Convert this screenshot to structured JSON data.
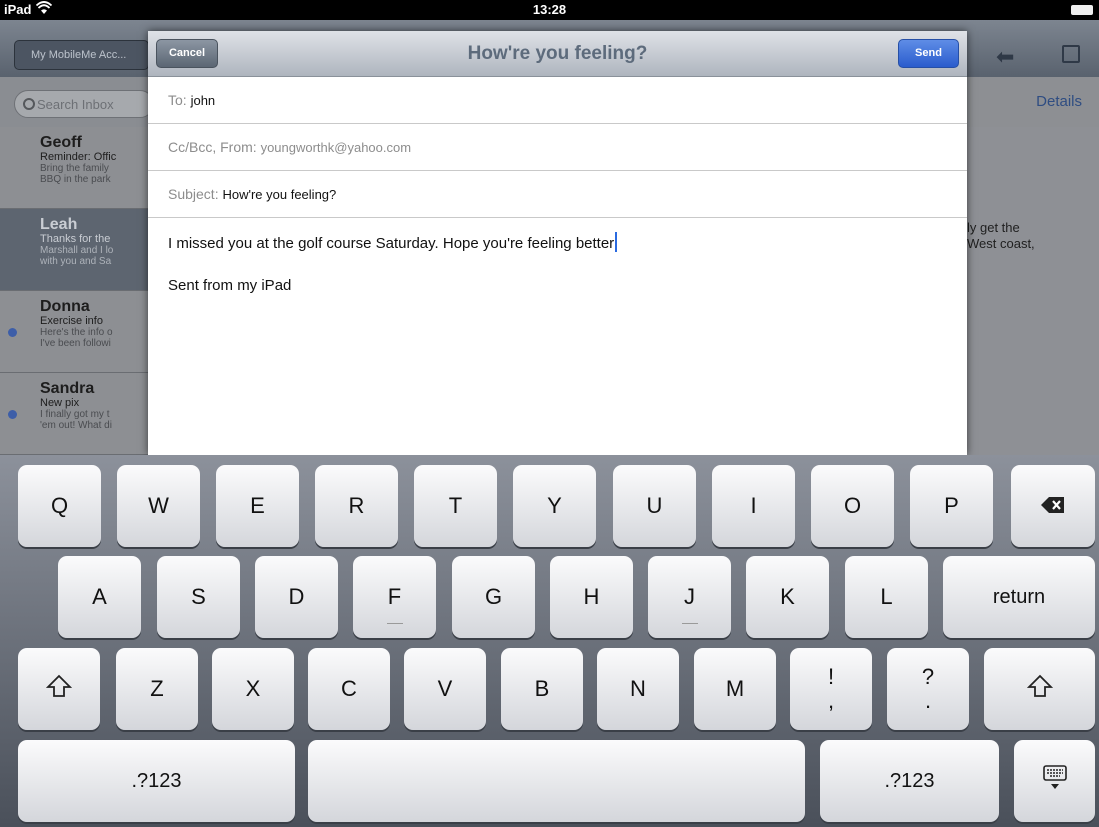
{
  "status": {
    "carrier": "iPad",
    "time": "13:28"
  },
  "background": {
    "back_label": "My MobileMe Acc...",
    "search_placeholder": "Search Inbox",
    "details_label": "Details",
    "right_snippet_line1": "ly get the",
    "right_snippet_line2": "West coast,",
    "messages": [
      {
        "from": "Geoff",
        "subject": "Reminder: Offic",
        "preview1": "Bring the family",
        "preview2": "BBQ in the park",
        "unread": false,
        "selected": false
      },
      {
        "from": "Leah",
        "subject": "Thanks for the",
        "preview1": "Marshall and I lo",
        "preview2": "with you and Sa",
        "unread": false,
        "selected": true
      },
      {
        "from": "Donna",
        "subject": "Exercise info",
        "preview1": "Here's the info o",
        "preview2": "I've been followi",
        "unread": true,
        "selected": false
      },
      {
        "from": "Sandra",
        "subject": "New pix",
        "preview1": "I finally got my t",
        "preview2": "'em out! What di",
        "unread": true,
        "selected": false
      }
    ]
  },
  "compose": {
    "title": "How're you feeling?",
    "cancel_label": "Cancel",
    "send_label": "Send",
    "to_label": "To:",
    "to_value": "john",
    "ccfrom_label": "Cc/Bcc, From:",
    "from_value": "youngworthk@yahoo.com",
    "subject_label": "Subject:",
    "subject_value": "How're you feeling?",
    "body": "I missed you at the golf course Saturday. Hope you're feeling better",
    "signature": "Sent from my iPad"
  },
  "keyboard": {
    "row1": [
      "Q",
      "W",
      "E",
      "R",
      "T",
      "Y",
      "U",
      "I",
      "O",
      "P"
    ],
    "row2": [
      "A",
      "S",
      "D",
      "F",
      "G",
      "H",
      "J",
      "K",
      "L"
    ],
    "return_label": "return",
    "row3": [
      "Z",
      "X",
      "C",
      "V",
      "B",
      "N",
      "M"
    ],
    "punct1_top": "!",
    "punct1_bottom": ",",
    "punct2_top": "?",
    "punct2_bottom": ".",
    "numbers_label": ".?123"
  }
}
